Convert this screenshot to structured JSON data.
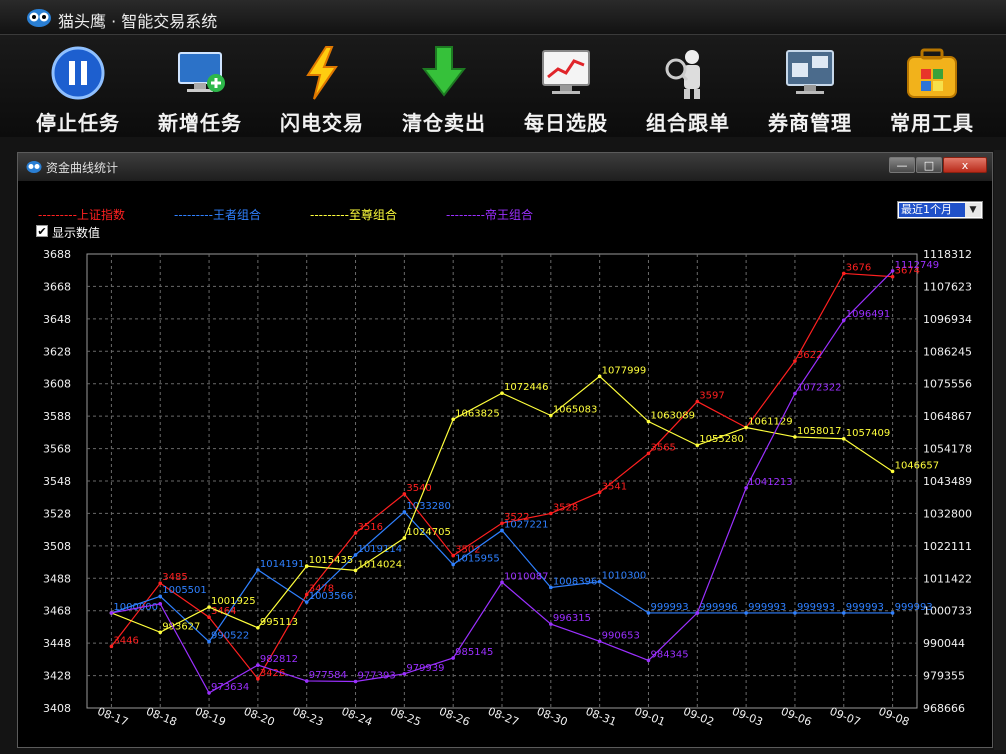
{
  "app": {
    "title": "猫头鹰 · 智能交易系统"
  },
  "toolbar": [
    {
      "label": "停止任务",
      "icon": "pause-icon"
    },
    {
      "label": "新增任务",
      "icon": "monitor-add-icon"
    },
    {
      "label": "闪电交易",
      "icon": "lightning-icon"
    },
    {
      "label": "清仓卖出",
      "icon": "download-arrow-icon"
    },
    {
      "label": "每日选股",
      "icon": "stock-chart-monitor-icon"
    },
    {
      "label": "组合跟单",
      "icon": "magnifier-person-icon"
    },
    {
      "label": "券商管理",
      "icon": "broker-monitor-icon"
    },
    {
      "label": "常用工具",
      "icon": "toolbox-icon"
    }
  ],
  "window": {
    "title": "资金曲线统计",
    "buttons": {
      "minimize": "—",
      "maximize": "□",
      "close": "x"
    },
    "period_select": "最近1个月",
    "show_values": {
      "label": "显示数值",
      "checked": true
    }
  },
  "colors": {
    "index": "#ff2020",
    "wangzhe": "#2f80ff",
    "zhizun": "#ffff3c",
    "diwang": "#9b30ff"
  },
  "chart_data": {
    "type": "line",
    "x": [
      "08-17",
      "08-18",
      "08-19",
      "08-20",
      "08-23",
      "08-24",
      "08-25",
      "08-26",
      "08-27",
      "08-30",
      "08-31",
      "09-01",
      "09-02",
      "09-03",
      "09-06",
      "09-07",
      "09-08"
    ],
    "left_axis": {
      "ylim": [
        3408,
        3688
      ],
      "ticks": [
        "3688",
        "3668",
        "3648",
        "3628",
        "3608",
        "3588",
        "3568",
        "3548",
        "3528",
        "3508",
        "3488",
        "3468",
        "3448",
        "3428",
        "3408"
      ]
    },
    "right_axis": {
      "ylim": [
        968666,
        1118312
      ],
      "ticks": [
        "1118312",
        "1107623",
        "1096934",
        "1086245",
        "1075556",
        "1064867",
        "1054178",
        "1043489",
        "1032800",
        "1022111",
        "1011422",
        "1000733",
        "990044",
        "979355",
        "968666"
      ]
    },
    "grid": true,
    "legend": "top-left",
    "series": [
      {
        "name": "---------上证指数",
        "key": "index",
        "axis": "left",
        "values": [
          3446,
          3485,
          3464,
          3426,
          3478,
          3516,
          3540,
          3502,
          3522,
          3528,
          3541,
          3565,
          3597,
          3581,
          3622,
          3676,
          3674
        ],
        "labels": [
          "3446",
          "3485",
          "3464",
          "3426",
          "3478",
          "3516",
          "3540",
          "3502",
          "3522",
          "3528",
          "3541",
          "3565",
          "3597",
          "",
          "3622",
          "3676",
          "3674"
        ]
      },
      {
        "name": "---------王者组合",
        "key": "wangzhe",
        "axis": "right",
        "values": [
          1000000,
          1005501,
          990522,
          1014191,
          1003566,
          1019114,
          1033280,
          1015955,
          1027221,
          1008396,
          1010300,
          999993,
          999996,
          999993,
          999993,
          999993,
          999993
        ],
        "labels": [
          "1000000",
          "1005501",
          "990522",
          "1014191",
          "1003566",
          "1019114",
          "1033280",
          "1015955",
          "1027221",
          "1008396",
          "1010300",
          "999993",
          "999996",
          "999993",
          "999993",
          "999993",
          "999993"
        ]
      },
      {
        "name": "---------至尊组合",
        "key": "zhizun",
        "axis": "right",
        "values": [
          1000000,
          993627,
          1001925,
          995113,
          1015435,
          1014024,
          1024705,
          1063825,
          1072446,
          1065083,
          1077999,
          1063089,
          1055280,
          1061129,
          1058017,
          1057409,
          1046657
        ],
        "labels": [
          "",
          "993627",
          "1001925",
          "995113",
          "1015435",
          "1014024",
          "1024705",
          "1063825",
          "1072446",
          "1065083",
          "1077999",
          "1063089",
          "1055280",
          "1061129",
          "1058017",
          "1057409",
          "1046657"
        ]
      },
      {
        "name": "---------帝王组合",
        "key": "diwang",
        "axis": "right",
        "values": [
          1000000,
          1003000,
          973634,
          982812,
          977584,
          977393,
          979939,
          985145,
          1010087,
          996315,
          990653,
          984345,
          999996,
          1041213,
          1072322,
          1096491,
          1112749
        ],
        "labels": [
          "",
          "",
          "973634",
          "982812",
          "977584",
          "977393",
          "979939",
          "985145",
          "1010087",
          "996315",
          "990653",
          "984345",
          "",
          "1041213",
          "1072322",
          "1096491",
          "1112749"
        ]
      }
    ]
  }
}
